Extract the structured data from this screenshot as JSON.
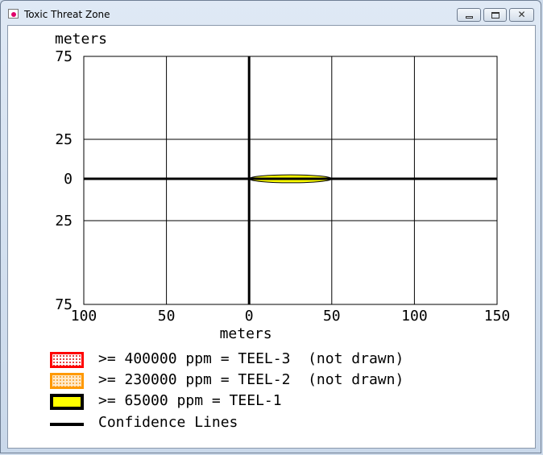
{
  "window": {
    "title": "Toxic Threat Zone",
    "buttons": {
      "minimize": "minimize",
      "maximize": "maximize",
      "close": "✕"
    }
  },
  "plot": {
    "y_unit_label": "meters",
    "x_unit_label": "meters",
    "y_ticks": [
      "75",
      "25",
      "0",
      "25",
      "75"
    ],
    "x_ticks": [
      "100",
      "50",
      "0",
      "50",
      "100",
      "150"
    ]
  },
  "legend": [
    {
      "label": ">= 400000 ppm = TEEL-3  (not drawn)",
      "swatch": "red-dotted",
      "color": "#ff0000"
    },
    {
      "label": ">= 230000 ppm = TEEL-2  (not drawn)",
      "swatch": "orange-dotted",
      "color": "#ff9900"
    },
    {
      "label": ">= 65000 ppm = TEEL-1",
      "swatch": "yellow-fill",
      "color": "#ffff00"
    },
    {
      "label": "Confidence Lines",
      "swatch": "black-line",
      "color": "#000000"
    }
  ],
  "chart_data": {
    "type": "area",
    "x_range": [
      -100,
      150
    ],
    "y_range": [
      -75,
      75
    ],
    "x_gridlines": [
      -100,
      -50,
      0,
      50,
      100,
      150
    ],
    "y_gridlines": [
      -75,
      -25,
      0,
      25,
      75
    ],
    "threat_zone_teel1": {
      "shape": "ellipse",
      "x_start": 0,
      "x_end": 50,
      "half_width": 2.5,
      "color": "#ffff00"
    },
    "confidence_lines": {
      "y": 0,
      "x_start": -100,
      "x_end": 150
    }
  }
}
